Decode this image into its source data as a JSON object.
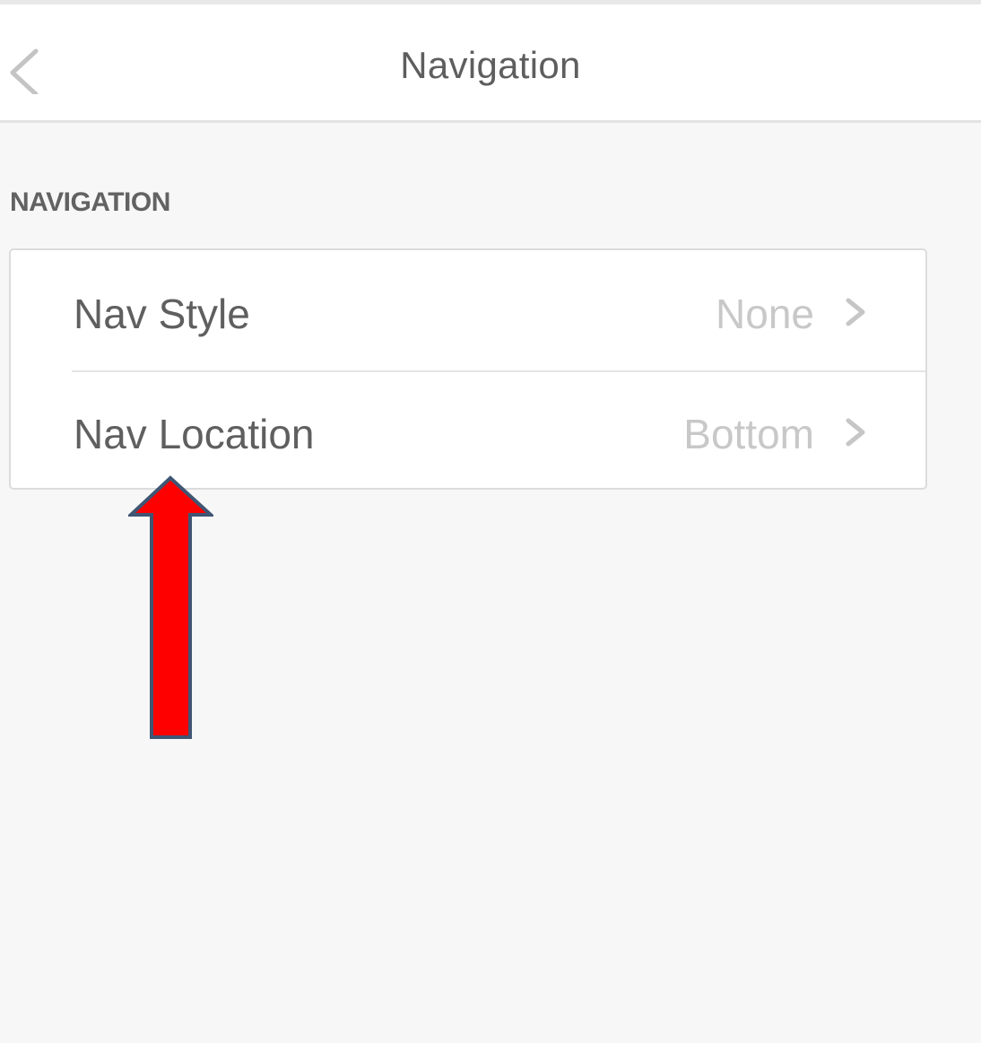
{
  "header": {
    "title": "Navigation",
    "back_icon": "chevron-left-icon"
  },
  "section": {
    "heading": "NAVIGATION",
    "rows": [
      {
        "label": "Nav Style",
        "value": "None",
        "icon": "chevron-right-icon"
      },
      {
        "label": "Nav Location",
        "value": "Bottom",
        "icon": "chevron-right-icon"
      }
    ]
  },
  "annotation": {
    "icon": "up-arrow-icon",
    "fill_color": "#ff0000",
    "stroke_color": "#3f5573"
  }
}
